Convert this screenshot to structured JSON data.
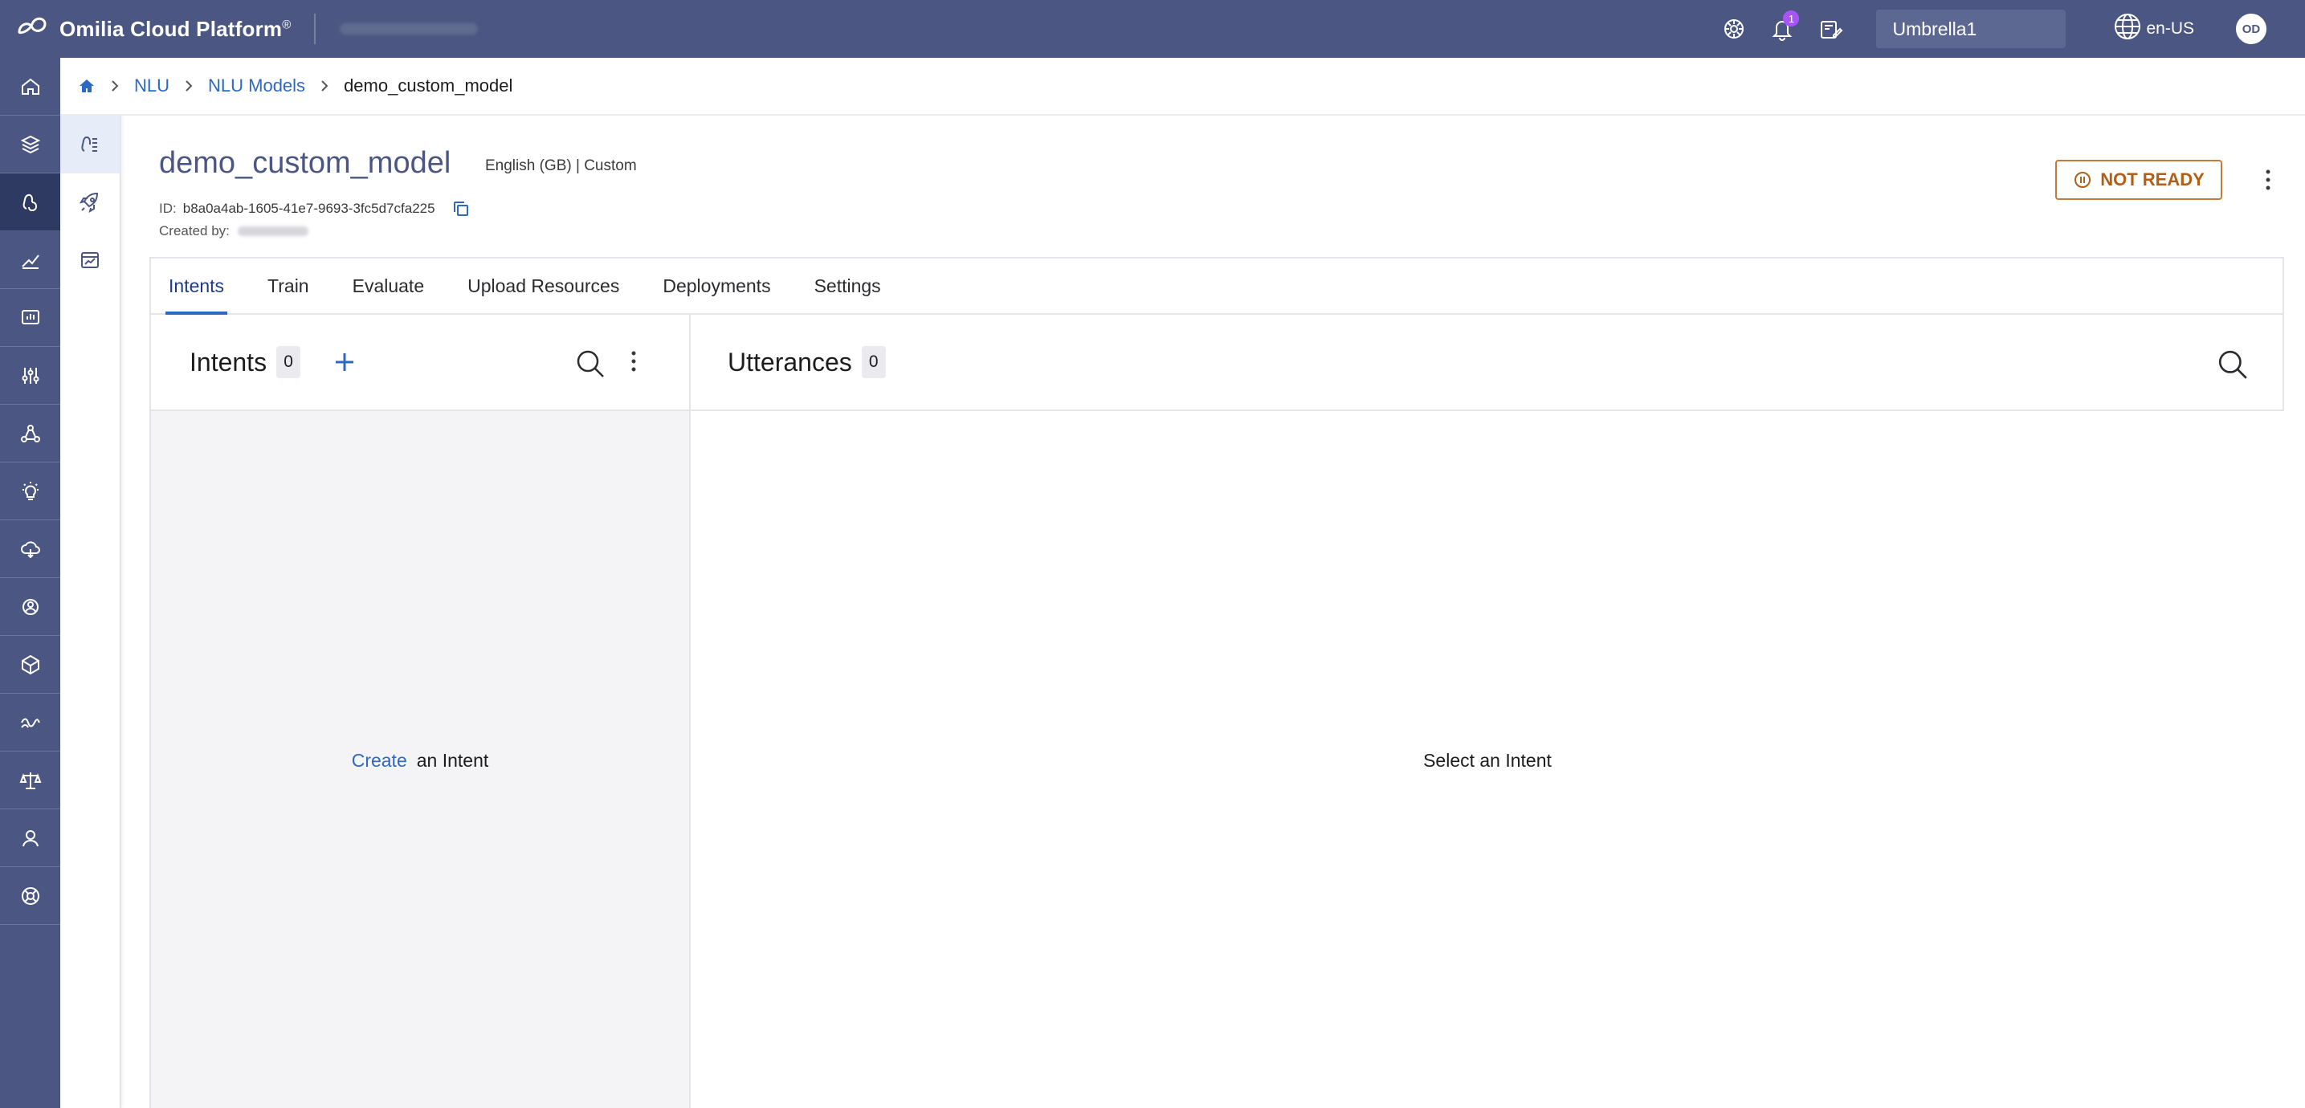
{
  "topbar": {
    "brand_name": "Omilia Cloud Platform",
    "brand_mark": "®",
    "notifications_count": "1",
    "workspace": "Umbrella1",
    "locale": "en-US",
    "avatar_initials": "OD"
  },
  "rail": {
    "items": [
      {
        "icon": "home-icon"
      },
      {
        "icon": "layers-icon"
      },
      {
        "icon": "nlu-icon",
        "active": true
      },
      {
        "icon": "analytics-icon"
      },
      {
        "icon": "dashboard-icon"
      },
      {
        "icon": "sliders-icon"
      },
      {
        "icon": "network-icon"
      },
      {
        "icon": "lightbulb-icon"
      },
      {
        "icon": "cloud-icon"
      },
      {
        "icon": "gear-group-icon"
      },
      {
        "icon": "cube-icon"
      },
      {
        "icon": "wave-icon"
      },
      {
        "icon": "scale-icon"
      },
      {
        "icon": "user-icon"
      },
      {
        "icon": "support-icon"
      }
    ]
  },
  "subrail": {
    "items": [
      {
        "icon": "nlu-models-icon",
        "active": true
      },
      {
        "icon": "rocket-icon"
      },
      {
        "icon": "report-icon"
      }
    ]
  },
  "breadcrumb": {
    "items": [
      "NLU",
      "NLU Models"
    ],
    "current": "demo_custom_model"
  },
  "model": {
    "name": "demo_custom_model",
    "meta": "English (GB) | Custom",
    "id_label": "ID:",
    "id": "b8a0a4ab-1605-41e7-9693-3fc5d7cfa225",
    "created_by_label": "Created by:",
    "status": "NOT READY"
  },
  "tabs": [
    {
      "label": "Intents",
      "active": true
    },
    {
      "label": "Train"
    },
    {
      "label": "Evaluate"
    },
    {
      "label": "Upload Resources"
    },
    {
      "label": "Deployments"
    },
    {
      "label": "Settings"
    }
  ],
  "intents_pane": {
    "title": "Intents",
    "count": "0",
    "empty_link": "Create",
    "empty_text": "an Intent"
  },
  "utterances_pane": {
    "title": "Utterances",
    "count": "0",
    "empty_text": "Select an Intent"
  },
  "colors": {
    "topbar": "#4b5782",
    "rail_active": "#2f3a63",
    "link": "#2d68c4",
    "status": "#b05e18"
  }
}
